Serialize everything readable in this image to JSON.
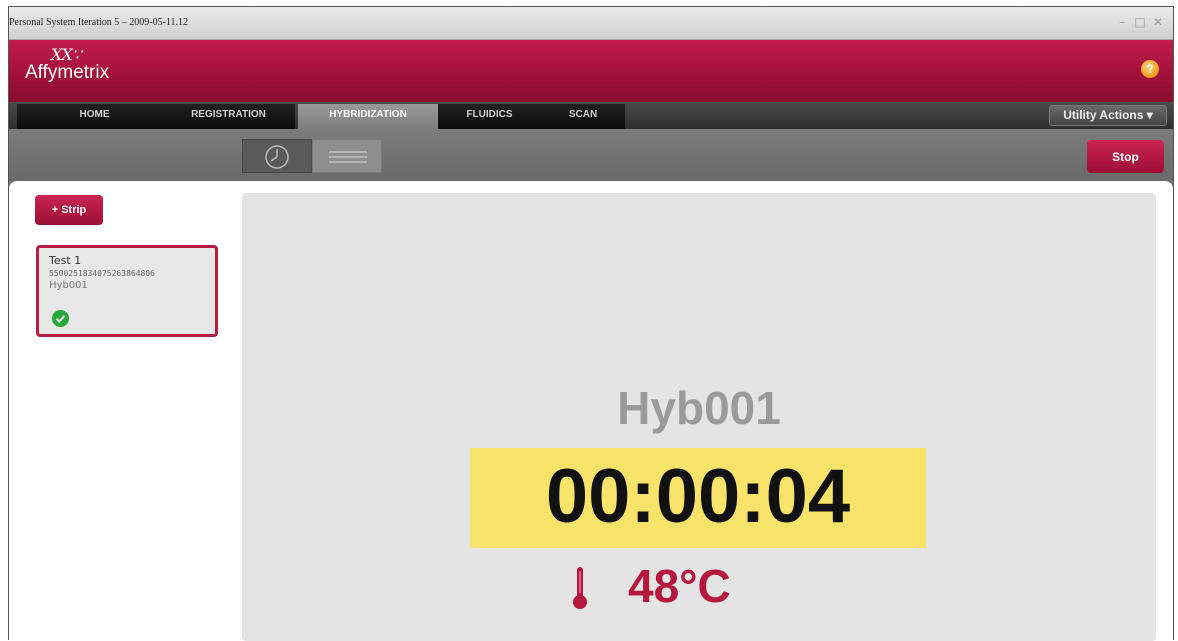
{
  "window": {
    "title": "Personal System Iteration 5 – 2009-05-11.12",
    "controls": [
      "–",
      "□",
      "✕"
    ]
  },
  "brand": {
    "logo_mark": "XX∵",
    "logo_text": "Affymetrix",
    "help_glyph": "?"
  },
  "nav": {
    "tabs": [
      {
        "label": "HOME"
      },
      {
        "label": "REGISTRATION"
      },
      {
        "label": "HYBRIDIZATION"
      },
      {
        "label": "FLUIDICS"
      },
      {
        "label": "SCAN"
      }
    ],
    "active_tab": "HYBRIDIZATION",
    "utility_label": "Utility Actions ▾"
  },
  "toolbar": {
    "views": [
      {
        "icon": "clock-icon"
      },
      {
        "icon": "list-icon"
      }
    ],
    "stop_label": "Stop"
  },
  "sidebar": {
    "add_strip_label": "+ Strip",
    "strips": [
      {
        "name": "Test 1",
        "barcode": "550025183407526386480​6",
        "hyb": "Hyb001",
        "status": "check-icon"
      }
    ]
  },
  "monitor": {
    "hyb_name": "Hyb001",
    "timer": "00:00:04",
    "temperature": "48°C"
  },
  "colors": {
    "brand_red": "#a3113a",
    "timer_bg": "#f8e36a",
    "temp_text": "#b5173f",
    "ok_green": "#26a83b"
  }
}
